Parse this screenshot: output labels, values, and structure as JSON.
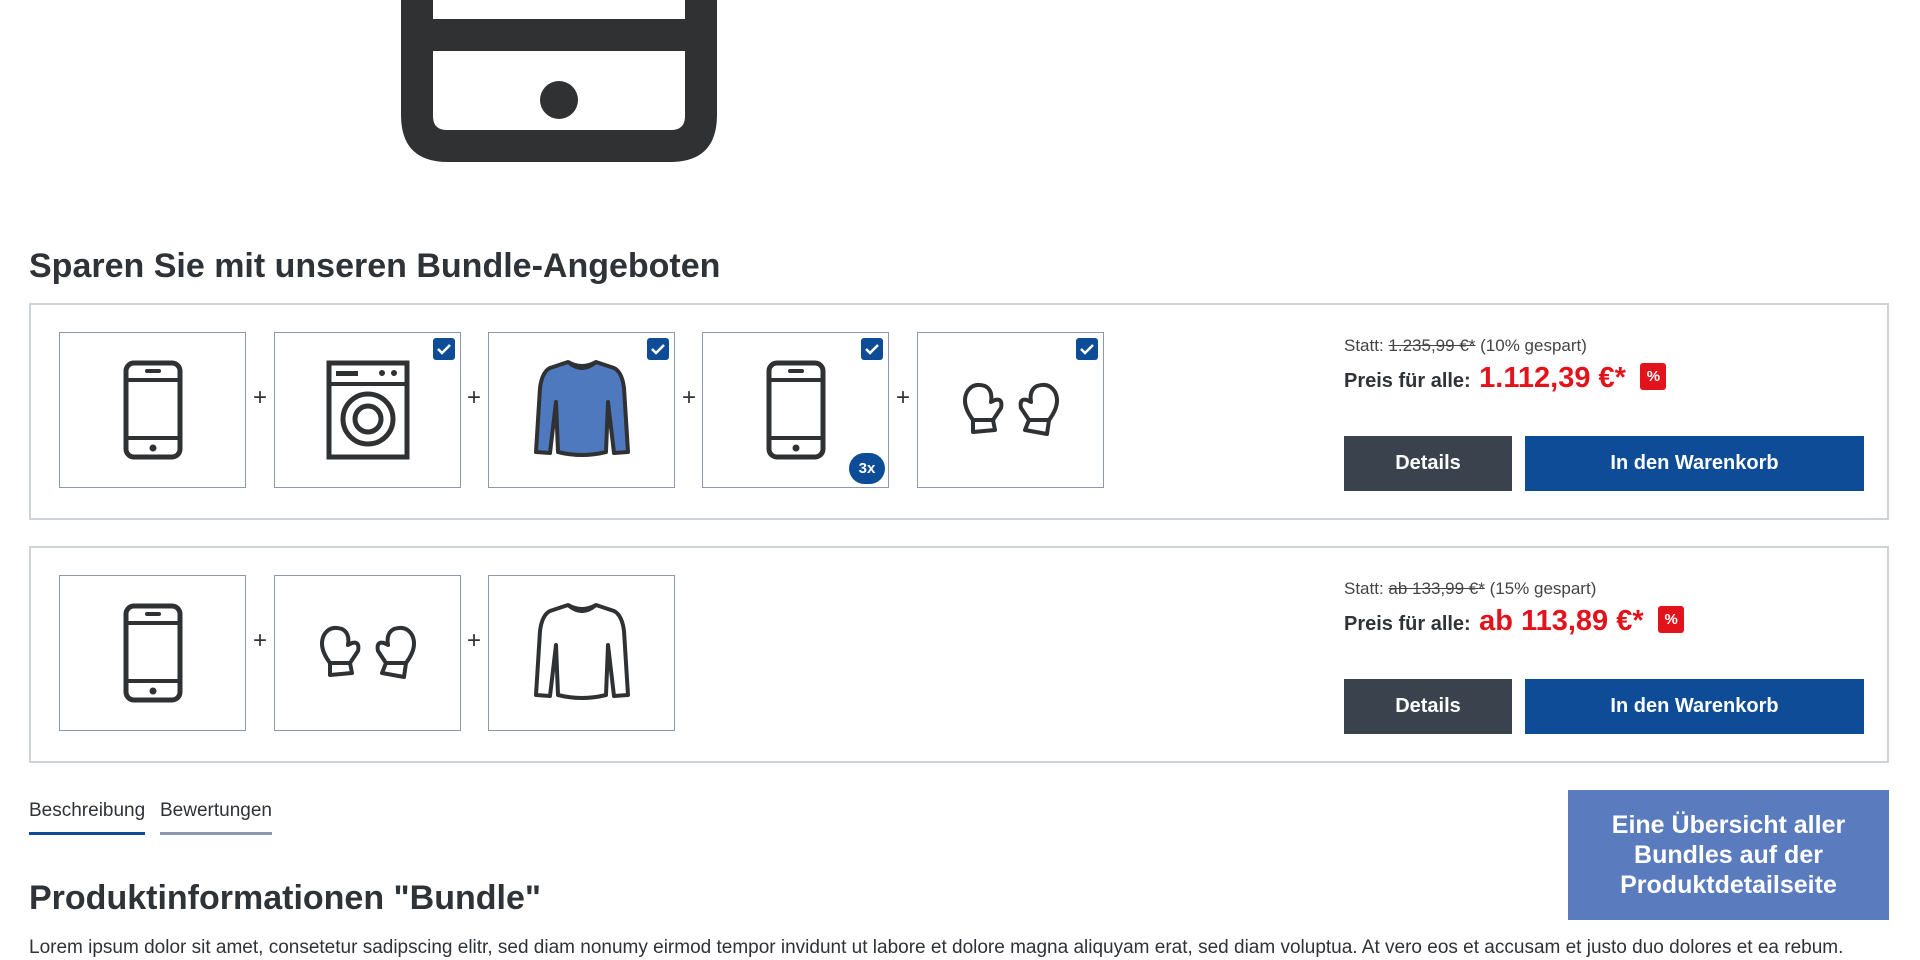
{
  "bundles_section": {
    "title": "Sparen Sie mit unseren Bundle-Angeboten",
    "bundles": [
      {
        "products": [
          {
            "icon": "smartphone-icon",
            "checked": false
          },
          {
            "icon": "washing-machine-icon",
            "checked": true
          },
          {
            "icon": "longsleeve-shirt-icon",
            "checked": true,
            "color": "#4f79be"
          },
          {
            "icon": "smartphone-icon",
            "checked": true,
            "quantity": "3x"
          },
          {
            "icon": "mittens-icon",
            "checked": true
          }
        ],
        "plus": "+",
        "statt_label": "Statt:",
        "statt_price": "1.235,99 €*",
        "saved": "(10% gespart)",
        "preis_label": "Preis für alle:",
        "price": "1.112,39 €*",
        "discount_badge": "%",
        "details_label": "Details",
        "cart_label": "In den Warenkorb"
      },
      {
        "products": [
          {
            "icon": "smartphone-icon",
            "checked": false
          },
          {
            "icon": "mittens-icon",
            "checked": false
          },
          {
            "icon": "longsleeve-shirt-outline-icon",
            "checked": false
          }
        ],
        "plus": "+",
        "statt_label": "Statt:",
        "statt_price": "ab 133,99 €*",
        "saved": "(15% gespart)",
        "preis_label": "Preis für alle:",
        "price": "ab 113,89 €*",
        "discount_badge": "%",
        "details_label": "Details",
        "cart_label": "In den Warenkorb"
      }
    ]
  },
  "tabs": [
    "Beschreibung",
    "Bewertungen"
  ],
  "overview_banner": "Eine Übersicht aller Bundles auf der Produktdetailseite",
  "product_info": {
    "title": "Produktinformationen \"Bundle\"",
    "text": "Lorem ipsum dolor sit amet, consetetur sadipscing elitr, sed diam nonumy eirmod tempor invidunt ut labore et dolore magna aliquyam erat, sed diam voluptua. At vero eos et accusam et justo duo dolores et ea rebum."
  },
  "colors": {
    "primary_blue": "#0e4c98",
    "price_red": "#e3131b",
    "details_button": "#3a434d",
    "banner": "#5b7bbf"
  }
}
